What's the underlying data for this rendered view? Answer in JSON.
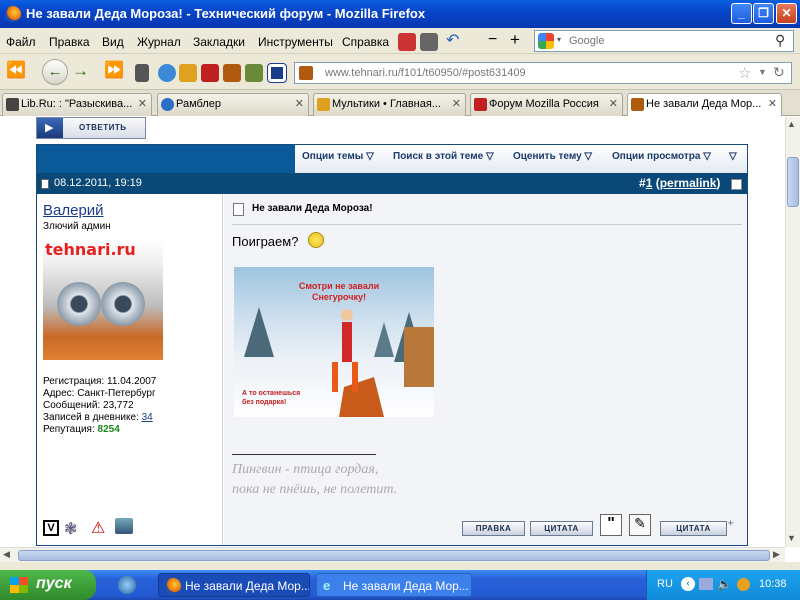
{
  "window": {
    "title": "Не завали Деда Мороза! - Технический форум - Mozilla Firefox"
  },
  "menu": [
    "Файл",
    "Правка",
    "Вид",
    "Журнал",
    "Закладки",
    "Инструменты",
    "Справка"
  ],
  "search": {
    "placeholder": "Google"
  },
  "url": "www.tehnari.ru/f101/t60950/#post631409",
  "tabs": [
    {
      "label": "Lib.Ru: : \"Разыскива...",
      "color": "#444"
    },
    {
      "label": "Рамблер",
      "color": "#2a70c8"
    },
    {
      "label": "Мультики • Главная...",
      "color": "#e0a020"
    },
    {
      "label": "Форум Mozilla Россия",
      "color": "#c02020"
    },
    {
      "label": "Не завали Деда Мор...",
      "color": "#b05a10",
      "active": true
    }
  ],
  "forum": {
    "reply_button": "ОТВЕТИТЬ",
    "options": [
      "Опции темы",
      "Поиск в этой теме",
      "Оценить тему",
      "Опции просмотра"
    ],
    "post": {
      "date": "08.12.2011, 19:19",
      "number_prefix": "#",
      "number": "1",
      "permalink": "permalink",
      "author": "Валерий",
      "user_title": "Злючий админ",
      "avatar_text": "tehnari.ru",
      "reg_label": "Регистрация:",
      "reg_value": "11.04.2007",
      "addr_label": "Адрес:",
      "addr_value": "Санкт-Петербург",
      "msgs_label": "Сообщений:",
      "msgs_value": "23,772",
      "diary_label": "Записей в дневнике:",
      "diary_value": "34",
      "rep_label": "Репутация:",
      "rep_value": "8254",
      "subject": "Не завали Деда Мороза!",
      "body": "Поиграем?",
      "image_top": "Смотри не завали Снегурочку!",
      "image_bottom": "А то останешься без подарка!",
      "signature_1": "Пингвин - птица гордая,",
      "signature_2": "пока не пнёшь, не полетит.",
      "btn_edit": "ПРАВКА",
      "btn_quote": "ЦИТАТА",
      "btn_multiquote": "ЦИТАТА"
    }
  },
  "taskbar": {
    "start": "пуск",
    "tasks": [
      "Не завали Деда Мор...",
      "Не завали Деда Мор..."
    ],
    "lang": "RU",
    "time": "10:38"
  }
}
